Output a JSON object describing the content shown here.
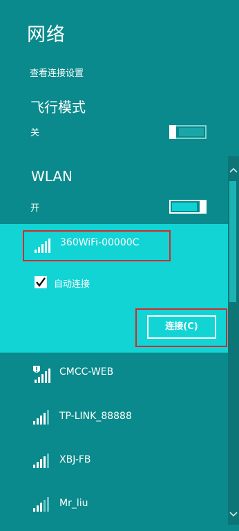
{
  "panel": {
    "title": "网络",
    "view_settings": "查看连接设置"
  },
  "airplane": {
    "title": "飞行模式",
    "state": "关",
    "enabled": false
  },
  "wlan": {
    "title": "WLAN",
    "state": "开",
    "enabled": true
  },
  "networks": [
    {
      "name": "360WiFi-00000C",
      "expanded": true,
      "secured": false,
      "auto_connect_label": "自动连接",
      "auto_connect": true,
      "connect_label": "连接(C)"
    },
    {
      "name": "CMCC-WEB",
      "secured": false,
      "warning": true
    },
    {
      "name": "TP-LINK_88888",
      "secured": false
    },
    {
      "name": "XBJ-FB",
      "secured": false
    },
    {
      "name": "Mr_liu",
      "secured": false
    }
  ],
  "icons": {
    "wifi": "wifi-signal-icon",
    "warning": "shield-warning-icon",
    "check": "checkmark-icon",
    "scroll_up": "chevron-up-icon",
    "scroll_down": "chevron-down-icon"
  },
  "colors": {
    "background": "#0a8a8c",
    "selected": "#12d4d5",
    "annotation": "#d22a2a"
  }
}
